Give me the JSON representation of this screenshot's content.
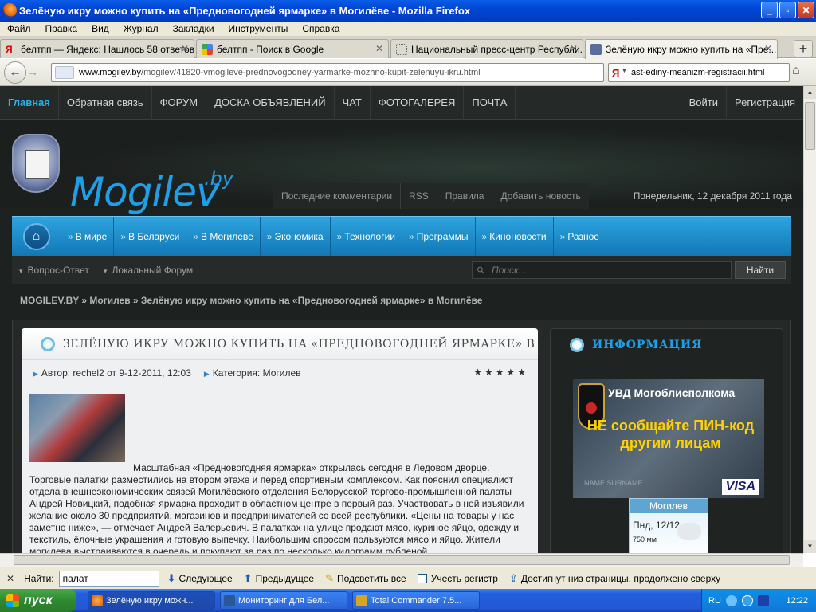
{
  "window": {
    "title": "Зелёную икру можно купить на «Предновогодней ярмарке» в Могилёве - Mozilla Firefox"
  },
  "menu": [
    "Файл",
    "Правка",
    "Вид",
    "Журнал",
    "Закладки",
    "Инструменты",
    "Справка"
  ],
  "tabs": [
    {
      "label": "белтпп — Яндекс: Нашлось 58 ответов"
    },
    {
      "label": "белтпп - Поиск в Google"
    },
    {
      "label": "Национальный пресс-центр Республи..."
    },
    {
      "label": "Зелёную икру можно купить на «Пре..."
    }
  ],
  "nav": {
    "url_host": "www.mogilev.by",
    "url_path": "/mogilev/41820-vmogileve-prednovogodney-yarmarke-mozhno-kupit-zelenuyu-ikru.html",
    "search_value": "ast-ediny-meanizm-registracii.html"
  },
  "site": {
    "topnav": [
      "Главная",
      "Обратная связь",
      "ФОРУМ",
      "ДОСКА ОБЪЯВЛЕНИЙ",
      "ЧАТ",
      "ФОТОГАЛЕРЕЯ",
      "ПОЧТА"
    ],
    "login": "Войти",
    "register": "Регистрация",
    "logo": "Mogilev",
    "logo_sup": ".by",
    "sublinks": [
      "Последние комментарии",
      "RSS",
      "Правила",
      "Добавить новость"
    ],
    "date": "Понедельник, 12 декабря 2011 года",
    "categories": [
      "В мире",
      "В Беларуси",
      "В Могилеве",
      "Экономика",
      "Технологии",
      "Программы",
      "Кинонoвости",
      "Разное"
    ],
    "subnav": [
      "Вопрос-Ответ",
      "Локальный Форум"
    ],
    "search_placeholder": "Поиск...",
    "search_button": "Найти",
    "breadcrumb": "MOGILEV.BY » Могилев » Зелёную икру можно купить на «Предновогодней ярмарке» в Могилёве"
  },
  "article": {
    "title": "ЗЕЛЁНУЮ ИКРУ МОЖНО КУПИТЬ НА «ПРЕДНОВОГОДНЕЙ ЯРМАРКЕ» В",
    "author": "Автор: rechel2 от 9-12-2011, 12:03",
    "category": "Категория: Могилев",
    "rating_stars": 5,
    "first_line": "Масштабная «Предновогодняя ярмарка» открылась сегодня в Ледовом дворце.",
    "text": "Торговые палатки разместились на втором этаже и перед спортивным комплексом. Как пояснил специалист отдела внешнеэкономических связей Могилёвского отделения Белорусской торгово-промышленной палаты Андрей Новицкий, подобная ярмарка проходит в областном центре в первый раз. Участвовать в ней изъявили желание около 30 предприятий, магазинов и предпринимателей со всей республики. «Цены на товары у нас заметно ниже», — отмечает Андрей Валерьевич. В палатках на улице продают мясо, куриное яйцо, одежду и текстиль, ёлочные украшения и готовую выпечку. Наибольшим спросом пользуются мясо и яйцо. Жители могилева выстраиваются в очередь и покупают за раз по несколько килограмм рубленой"
  },
  "sidebar": {
    "title": "ИНФОРМАЦИЯ",
    "banner_org": "УВД Могоблисполкома",
    "banner_msg": "НЕ сообщайте ПИН-код другим лицам",
    "banner_card": "VISA",
    "banner_name": "NAME SURNAME",
    "weather_city": "Могилев",
    "weather_day": "Пнд, 12/12",
    "weather_pressure": "750 мм"
  },
  "findbar": {
    "label": "Найти:",
    "value": "палат",
    "next": "Следующее",
    "prev": "Предыдущее",
    "highlight": "Подсветить все",
    "match_case": "Учесть регистр",
    "status": "Достигнут низ страницы, продолжено сверху"
  },
  "taskbar": {
    "start": "пуск",
    "items": [
      "Зелёную икру можн...",
      "Мониторинг для Бел...",
      "Total Commander 7.5..."
    ],
    "lang": "RU",
    "time": "12:22"
  }
}
